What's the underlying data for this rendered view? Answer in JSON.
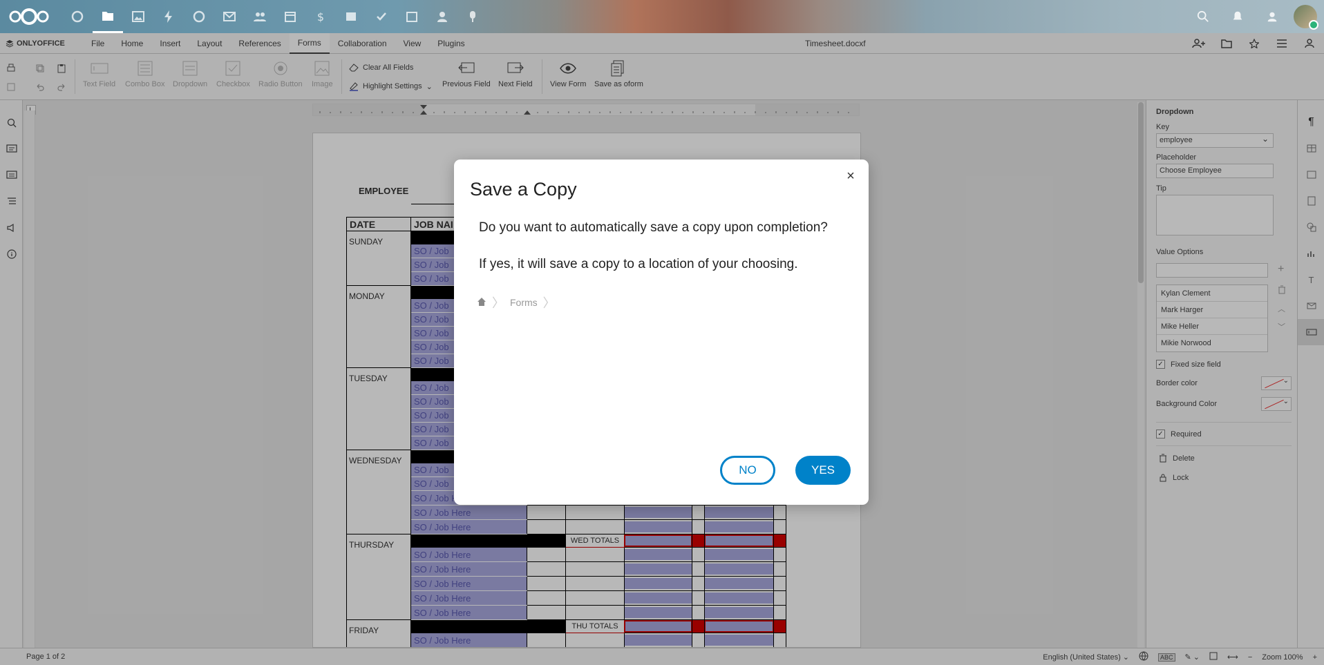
{
  "nextcloud": {
    "apps": [
      "dashboard-icon",
      "files-icon",
      "photos-icon",
      "activity-icon",
      "search-icon",
      "mail-icon",
      "contacts-icon",
      "calendar-icon",
      "money-icon",
      "deck-icon",
      "tasks-icon",
      "calendar2-icon",
      "user-icon",
      "pin-icon"
    ]
  },
  "onlyoffice": {
    "logo": "ONLYOFFICE",
    "tabs": [
      "File",
      "Home",
      "Insert",
      "Layout",
      "References",
      "Forms",
      "Collaboration",
      "View",
      "Plugins"
    ],
    "active_tab": "Forms",
    "doc_title": "Timesheet.docxf"
  },
  "toolbar": {
    "text_field": "Text Field",
    "combo_box": "Combo Box",
    "dropdown": "Dropdown",
    "checkbox": "Checkbox",
    "radio_button": "Radio Button",
    "image": "Image",
    "clear_all": "Clear All Fields",
    "highlight": "Highlight Settings",
    "previous_field": "Previous Field",
    "next_field": "Next Field",
    "view_form": "View Form",
    "save_oform": "Save as oform"
  },
  "document": {
    "employee_label": "EMPLOYEE",
    "col_date": "DATE",
    "col_job": "JOB NAI",
    "days": [
      "SUNDAY",
      "MONDAY",
      "TUESDAY",
      "WEDNESDAY",
      "THURSDAY",
      "FRIDAY"
    ],
    "job_short": "SO / Job",
    "job_full": "SO / Job Here",
    "wed_totals": "WED TOTALS",
    "thu_totals": "THU TOTALS"
  },
  "right_panel": {
    "title": "Dropdown",
    "key_label": "Key",
    "key_value": "employee",
    "placeholder_label": "Placeholder",
    "placeholder_value": "Choose Employee",
    "tip_label": "Tip",
    "value_options_label": "Value Options",
    "options": [
      "Kylan Clement",
      "Mark Harger",
      "Mike Heller",
      "Mikie Norwood"
    ],
    "fixed_size": "Fixed size field",
    "border_color": "Border color",
    "background_color": "Background Color",
    "required": "Required",
    "delete": "Delete",
    "lock": "Lock"
  },
  "status": {
    "page": "Page 1 of 2",
    "language": "English (United States)",
    "zoom": "Zoom 100%"
  },
  "dialog": {
    "title": "Save a Copy",
    "message1": "Do you want to automatically save a copy upon completion?",
    "message2": "If yes, it will save a copy to a location of your choosing.",
    "breadcrumb_folder": "Forms",
    "no": "NO",
    "yes": "YES"
  },
  "colors": {
    "accent": "#0082c9",
    "field": "#a9a9e0",
    "totals_red": "#d40000"
  }
}
